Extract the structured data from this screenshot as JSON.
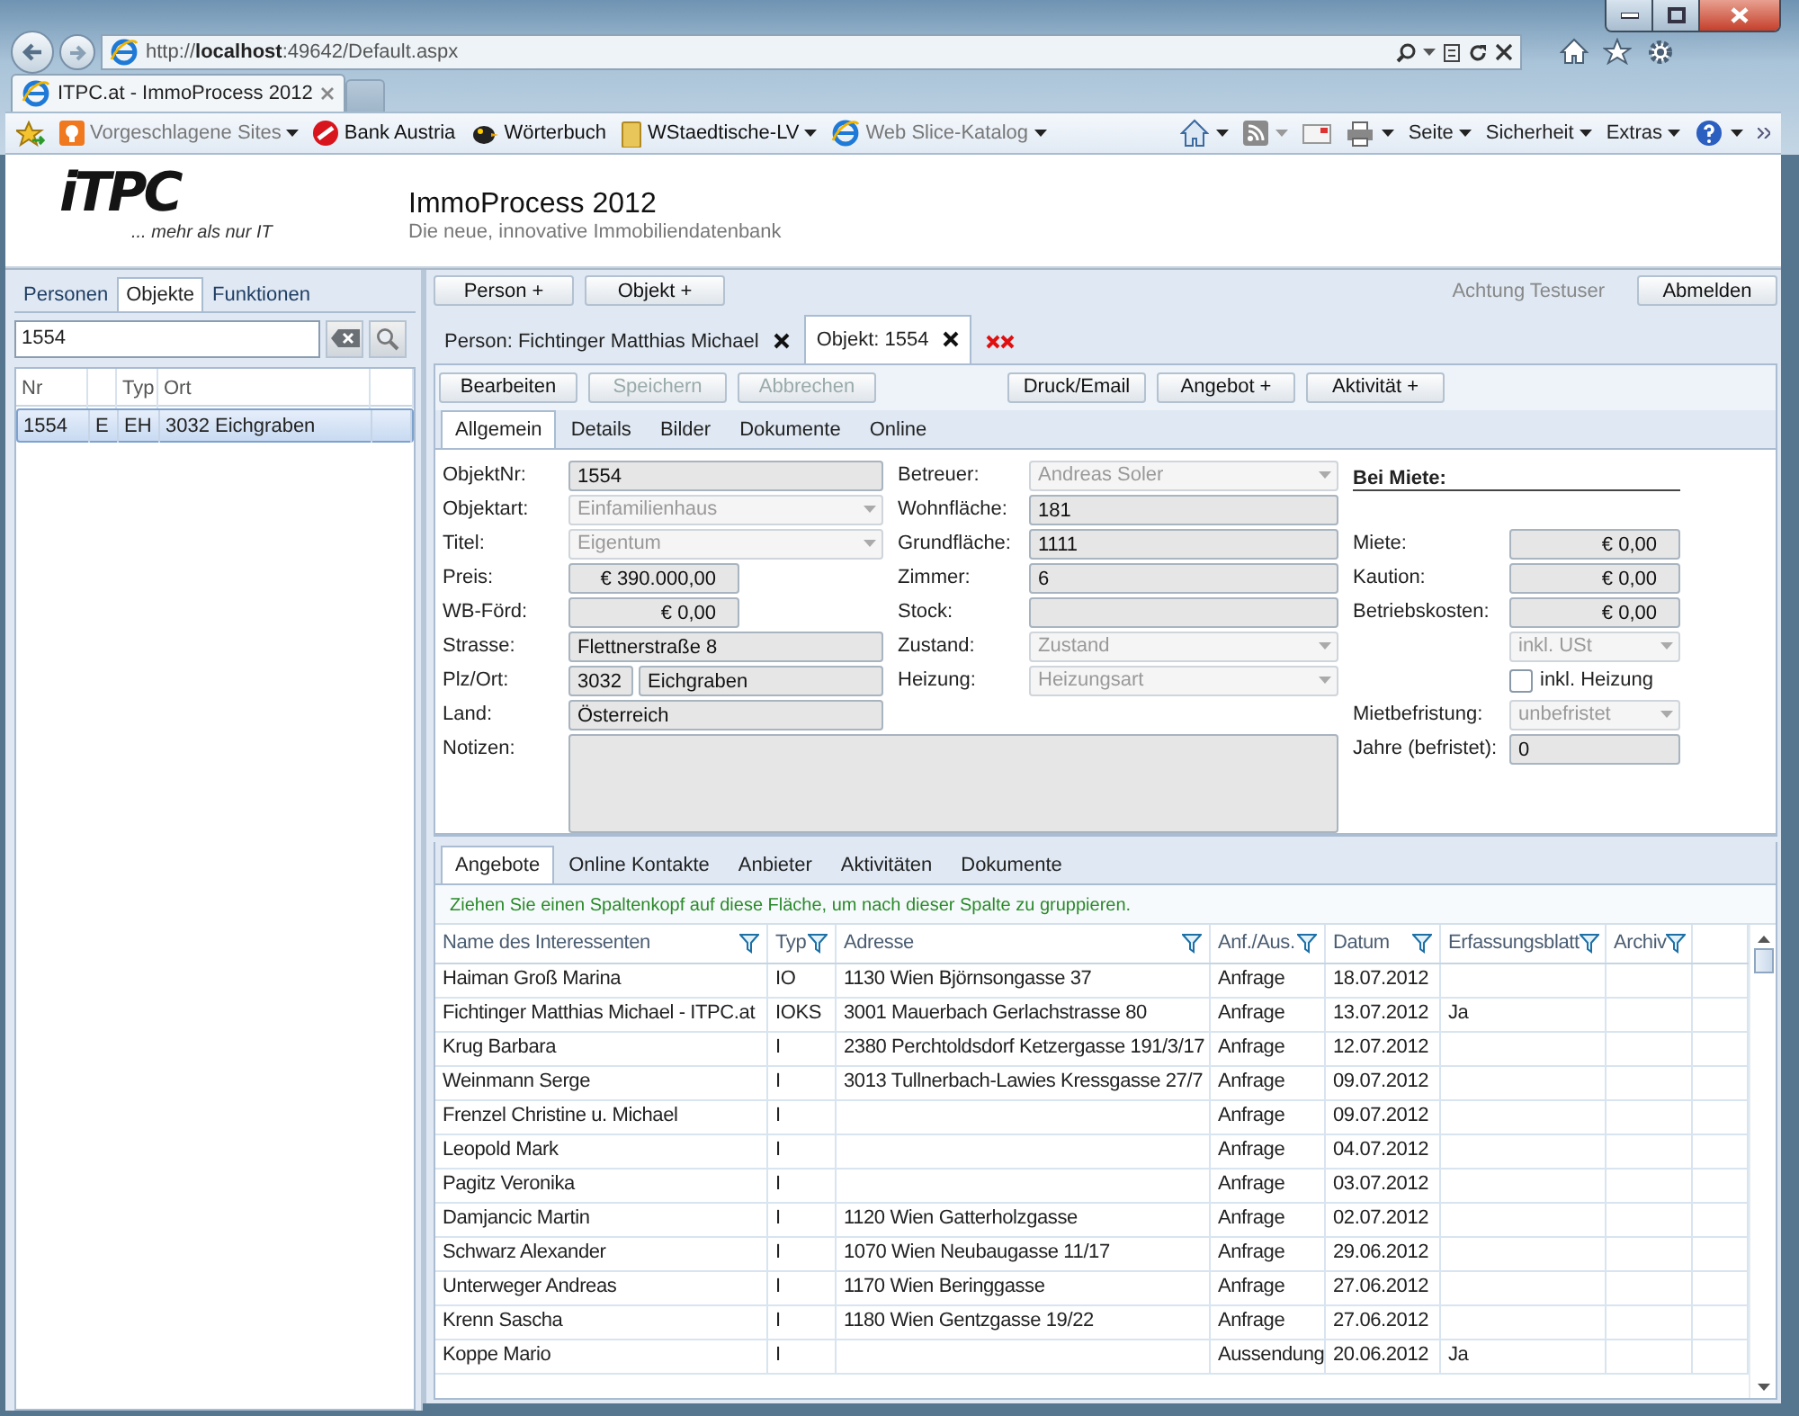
{
  "browser": {
    "address": "http://**localhost**:49642/Default.aspx",
    "tab_title": "ITPC.at - ImmoProcess 2012",
    "favorites": [
      {
        "label": "Vorgeschlagene Sites",
        "dropdown": true,
        "dimmed": true
      },
      {
        "label": "Bank Austria",
        "dropdown": false,
        "dimmed": false
      },
      {
        "label": "Wörterbuch",
        "dropdown": false,
        "dimmed": false
      },
      {
        "label": "WStaedtische-LV",
        "dropdown": true,
        "dimmed": false
      },
      {
        "label": "Web Slice-Katalog",
        "dropdown": true,
        "dimmed": true
      }
    ],
    "menus": [
      "Seite",
      "Sicherheit",
      "Extras"
    ]
  },
  "app": {
    "logo": "iTPC",
    "tagline": "... mehr als nur IT",
    "title": "ImmoProcess 2012",
    "subtitle": "Die neue, innovative Immobiliendatenbank"
  },
  "sidebar": {
    "tabs": [
      {
        "label": "Personen",
        "selected": false
      },
      {
        "label": "Objekte",
        "selected": true
      },
      {
        "label": "Funktionen",
        "selected": false
      }
    ],
    "search": {
      "value": "1554"
    },
    "columns": {
      "nr": "Nr",
      "typ": "Typ",
      "ort": "Ort"
    },
    "rows": [
      {
        "nr": "1554",
        "status": "E",
        "typ": "EH",
        "ort": "3032 Eichgraben",
        "selected": true
      }
    ]
  },
  "toolbar": {
    "buttons": [
      "Person +",
      "Objekt +"
    ],
    "user": "Achtung Testuser",
    "logout": "Abmelden"
  },
  "doc_tabs": [
    {
      "label": "Person: Fichtinger Matthias Michael",
      "selected": false
    },
    {
      "label": "Objekt: 1554",
      "selected": true
    }
  ],
  "action_groups": [
    [
      {
        "label": "Bearbeiten",
        "disabled": false
      },
      {
        "label": "Speichern",
        "disabled": true
      },
      {
        "label": "Abbrechen",
        "disabled": true
      }
    ],
    [
      {
        "label": "Druck/Email",
        "disabled": false
      },
      {
        "label": "Angebot +",
        "disabled": false
      },
      {
        "label": "Aktivität +",
        "disabled": false
      }
    ]
  ],
  "form_tabs": [
    {
      "label": "Allgemein",
      "selected": true
    },
    {
      "label": "Details",
      "selected": false
    },
    {
      "label": "Bilder",
      "selected": false
    },
    {
      "label": "Dokumente",
      "selected": false
    },
    {
      "label": "Online",
      "selected": false
    }
  ],
  "form": {
    "columns": [
      {
        "fields": [
          {
            "kind": "text",
            "label": "ObjektNr:",
            "value": "1554"
          },
          {
            "kind": "select",
            "label": "Objektart:",
            "value": "Einfamilienhaus",
            "disabled": true
          },
          {
            "kind": "select",
            "label": "Titel:",
            "value": "Eigentum",
            "disabled": true
          },
          {
            "kind": "money",
            "label": "Preis:",
            "value": "€ 390.000,00"
          },
          {
            "kind": "money",
            "label": "WB-Förd:",
            "value": "€ 0,00"
          },
          {
            "kind": "text",
            "label": "Strasse:",
            "value": "Flettnerstraße 8"
          },
          {
            "kind": "plz",
            "label": "Plz/Ort:",
            "value": "3032",
            "city": "Eichgraben"
          },
          {
            "kind": "text",
            "label": "Land:",
            "value": "Österreich"
          },
          {
            "kind": "textarea",
            "label": "Notizen:"
          }
        ]
      },
      {
        "fields": [
          {
            "kind": "select",
            "label": "Betreuer:",
            "value": "Andreas Soler",
            "disabled": true
          },
          {
            "kind": "text",
            "label": "Wohnfläche:",
            "value": "181"
          },
          {
            "kind": "text",
            "label": "Grundfläche:",
            "value": "1111"
          },
          {
            "kind": "text",
            "label": "Zimmer:",
            "value": "6"
          },
          {
            "kind": "text",
            "label": "Stock:"
          },
          {
            "kind": "select",
            "label": "Zustand:",
            "value": "Zustand",
            "disabled": true
          },
          {
            "kind": "select",
            "label": "Heizung:",
            "value": "Heizungsart",
            "disabled": true
          }
        ]
      },
      {
        "fields": [
          {
            "kind": "heading",
            "label": "Bei Miete:"
          },
          {
            "kind": "money",
            "label": "Miete:",
            "value": "€ 0,00"
          },
          {
            "kind": "money",
            "label": "Kaution:",
            "value": "€ 0,00"
          },
          {
            "kind": "money",
            "label": "Betriebskosten:",
            "value": "€ 0,00"
          },
          {
            "kind": "select",
            "value": "inkl. USt",
            "disabled": true
          },
          {
            "kind": "checkbox",
            "label": "inkl. Heizung",
            "checked": false
          },
          {
            "kind": "select",
            "label": "Mietbefristung:",
            "value": "unbefristet",
            "disabled": true
          },
          {
            "kind": "text",
            "label": "Jahre (befristet):",
            "value": "0"
          }
        ]
      }
    ]
  },
  "grid": {
    "tabs": [
      {
        "label": "Angebote",
        "selected": true
      },
      {
        "label": "Online Kontakte",
        "selected": false
      },
      {
        "label": "Anbieter",
        "selected": false
      },
      {
        "label": "Aktivitäten",
        "selected": false
      },
      {
        "label": "Dokumente",
        "selected": false
      }
    ],
    "group_hint": "Ziehen Sie einen Spaltenkopf auf diese Fläche, um nach dieser Spalte zu gruppieren.",
    "columns": {
      "name": "Name des Interessenten",
      "typ": "Typ",
      "adresse": "Adresse",
      "art": "Anf./Aus.",
      "datum": "Datum",
      "blatt": "Erfassungsblatt",
      "archiv": "Archiv"
    },
    "rows": [
      {
        "name": "Haiman Groß Marina",
        "typ": "IO",
        "adresse": "1130 Wien Björnsongasse 37",
        "art": "Anfrage",
        "datum": "18.07.2012"
      },
      {
        "name": "Fichtinger Matthias Michael - ITPC.at",
        "typ": "IOKS",
        "adresse": "3001 Mauerbach Gerlachstrasse 80",
        "art": "Anfrage",
        "datum": "13.07.2012",
        "blatt": "Ja"
      },
      {
        "name": "Krug Barbara",
        "typ": "I",
        "adresse": "2380 Perchtoldsdorf Ketzergasse 191/3/17",
        "art": "Anfrage",
        "datum": "12.07.2012"
      },
      {
        "name": "Weinmann Serge",
        "typ": "I",
        "adresse": "3013 Tullnerbach-Lawies Kressgasse 27/7",
        "art": "Anfrage",
        "datum": "09.07.2012"
      },
      {
        "name": "Frenzel Christine u. Michael",
        "typ": "I",
        "art": "Anfrage",
        "datum": "09.07.2012"
      },
      {
        "name": "Leopold Mark",
        "typ": "I",
        "art": "Anfrage",
        "datum": "04.07.2012"
      },
      {
        "name": "Pagitz Veronika",
        "typ": "I",
        "art": "Anfrage",
        "datum": "03.07.2012"
      },
      {
        "name": "Damjancic Martin",
        "typ": "I",
        "adresse": "1120 Wien Gatterholzgasse",
        "art": "Anfrage",
        "datum": "02.07.2012"
      },
      {
        "name": "Schwarz Alexander",
        "typ": "I",
        "adresse": "1070 Wien Neubaugasse 11/17",
        "art": "Anfrage",
        "datum": "29.06.2012"
      },
      {
        "name": "Unterweger Andreas",
        "typ": "I",
        "adresse": "1170 Wien Beringgasse",
        "art": "Anfrage",
        "datum": "27.06.2012"
      },
      {
        "name": "Krenn Sascha",
        "typ": "I",
        "adresse": "1180 Wien Gentzgasse 19/22",
        "art": "Anfrage",
        "datum": "27.06.2012"
      },
      {
        "name": "Koppe Mario",
        "typ": "I",
        "art": "Aussendung",
        "datum": "20.06.2012",
        "blatt": "Ja"
      }
    ]
  }
}
